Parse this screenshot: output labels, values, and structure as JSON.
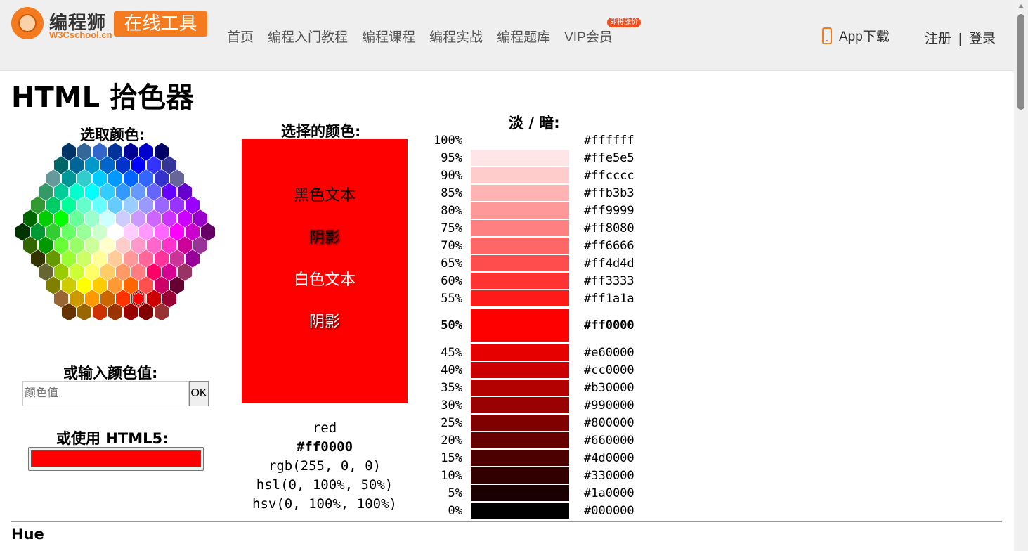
{
  "header": {
    "logo_name": "编程狮",
    "logo_sub": "W3Cschool.cn",
    "logo_badge": "在线工具",
    "nav": [
      "首页",
      "编程入门教程",
      "编程课程",
      "编程实战",
      "编程题库",
      "VIP会员"
    ],
    "hot_tag": "即将涨价",
    "app_download": "App下载",
    "register": "注册",
    "separator": "|",
    "login": "登录"
  },
  "page": {
    "title": "HTML 拾色器",
    "pick_color_label": "选取颜色:",
    "input_label": "或输入颜色值:",
    "input_placeholder": "颜色值",
    "ok_label": "OK",
    "html5_label": "或使用 HTML5:",
    "html5_value": "#ff0000",
    "selected_label": "选择的颜色:",
    "selected_color": "#ff0000",
    "sample_black_text": "黑色文本",
    "sample_shadow": "阴影",
    "sample_white_text": "白色文本",
    "color_name": "red",
    "hex": "#ff0000",
    "rgb": "rgb(255, 0, 0)",
    "hsl": "hsl(0, 100%, 50%)",
    "hsv": "hsv(0, 100%, 100%)",
    "shades_label": "淡 / 暗:",
    "hue_label": "Hue"
  },
  "shades": [
    {
      "pct": "100%",
      "hex": "#ffffff"
    },
    {
      "pct": "95%",
      "hex": "#ffe5e5"
    },
    {
      "pct": "90%",
      "hex": "#ffcccc"
    },
    {
      "pct": "85%",
      "hex": "#ffb3b3"
    },
    {
      "pct": "80%",
      "hex": "#ff9999"
    },
    {
      "pct": "75%",
      "hex": "#ff8080"
    },
    {
      "pct": "70%",
      "hex": "#ff6666"
    },
    {
      "pct": "65%",
      "hex": "#ff4d4d"
    },
    {
      "pct": "60%",
      "hex": "#ff3333"
    },
    {
      "pct": "55%",
      "hex": "#ff1a1a"
    },
    {
      "pct": "50%",
      "hex": "#ff0000",
      "current": true
    },
    {
      "pct": "45%",
      "hex": "#e60000"
    },
    {
      "pct": "40%",
      "hex": "#cc0000"
    },
    {
      "pct": "35%",
      "hex": "#b30000"
    },
    {
      "pct": "30%",
      "hex": "#990000"
    },
    {
      "pct": "25%",
      "hex": "#800000"
    },
    {
      "pct": "20%",
      "hex": "#660000"
    },
    {
      "pct": "15%",
      "hex": "#4d0000"
    },
    {
      "pct": "10%",
      "hex": "#330000"
    },
    {
      "pct": "5%",
      "hex": "#1a0000"
    },
    {
      "pct": "0%",
      "hex": "#000000"
    }
  ],
  "hex_picker_rows": [
    [
      "#003366",
      "#336699",
      "#3366CC",
      "#003399",
      "#000099",
      "#0000CC",
      "#000066"
    ],
    [
      "#006666",
      "#006699",
      "#0099CC",
      "#0066CC",
      "#0033CC",
      "#0000FF",
      "#3333FF",
      "#333399"
    ],
    [
      "#669999",
      "#009999",
      "#33CCCC",
      "#00CCFF",
      "#0099FF",
      "#0066FF",
      "#3366FF",
      "#3333CC",
      "#666699"
    ],
    [
      "#339966",
      "#00CC99",
      "#00FFCC",
      "#00FFFF",
      "#33CCFF",
      "#3399FF",
      "#6699FF",
      "#6666FF",
      "#6600FF",
      "#6600CC"
    ],
    [
      "#339933",
      "#00CC66",
      "#00FF99",
      "#66FFCC",
      "#66FFFF",
      "#66CCFF",
      "#99CCFF",
      "#9999FF",
      "#9966FF",
      "#9933FF",
      "#9900FF"
    ],
    [
      "#006600",
      "#00CC00",
      "#00FF00",
      "#66FF99",
      "#99FFCC",
      "#CCFFFF",
      "#CCCCFF",
      "#CC99FF",
      "#CC66FF",
      "#CC33FF",
      "#CC00FF",
      "#9900CC"
    ],
    [
      "#003300",
      "#009933",
      "#33CC33",
      "#66FF66",
      "#99FF99",
      "#CCFFCC",
      "#FFFFFF",
      "#FFCCFF",
      "#FF99FF",
      "#FF66FF",
      "#FF00FF",
      "#CC00CC",
      "#660066"
    ],
    [
      "#336600",
      "#009900",
      "#66FF33",
      "#99FF66",
      "#CCFF99",
      "#FFFFCC",
      "#FFCCCC",
      "#FF99CC",
      "#FF66CC",
      "#FF33CC",
      "#CC0099",
      "#993399"
    ],
    [
      "#333300",
      "#669900",
      "#99FF33",
      "#CCFF66",
      "#FFFF99",
      "#FFCC99",
      "#FF9999",
      "#FF6699",
      "#FF3399",
      "#CC3399",
      "#990099"
    ],
    [
      "#666633",
      "#99CC00",
      "#CCFF33",
      "#FFFF66",
      "#FFCC66",
      "#FF9966",
      "#FF7C80",
      "#FF0066",
      "#D60093",
      "#993366"
    ],
    [
      "#808000",
      "#CCCC00",
      "#FFFF00",
      "#FFCC00",
      "#FF9933",
      "#FF6600",
      "#FF5050",
      "#CC0066",
      "#660033"
    ],
    [
      "#996633",
      "#CC9900",
      "#FF9900",
      "#CC6600",
      "#FF3300",
      "#FF0000",
      "#CC0000",
      "#990033"
    ],
    [
      "#663300",
      "#996600",
      "#CC3300",
      "#993300",
      "#990000",
      "#800000",
      "#993333"
    ]
  ],
  "selected_hex_index": [
    11,
    5
  ]
}
